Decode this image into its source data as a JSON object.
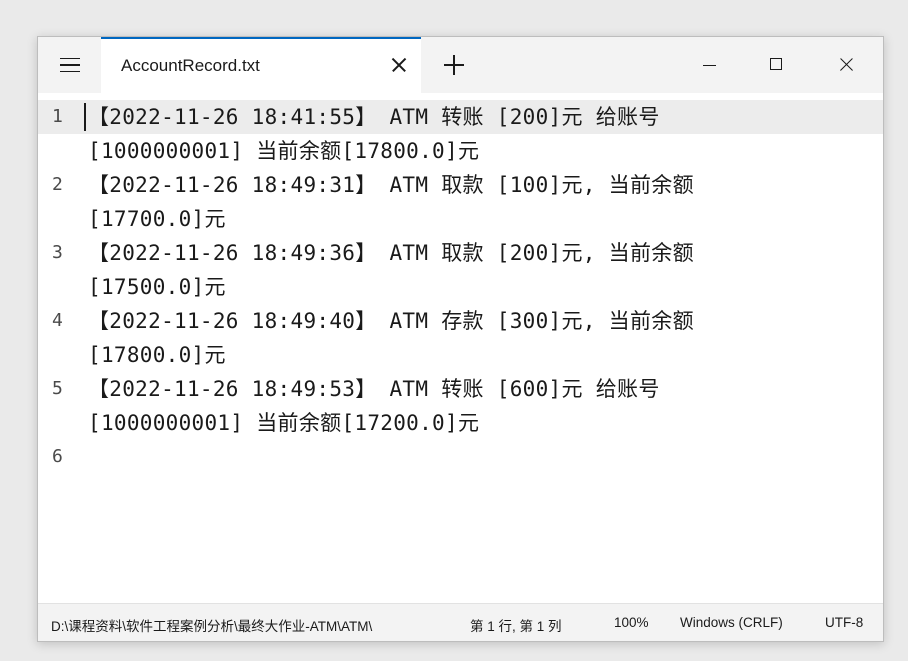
{
  "window": {
    "tab_title": "AccountRecord.txt"
  },
  "editor": {
    "lines": [
      {
        "number": "1",
        "text": "【2022-11-26 18:41:55】 ATM 转账 [200]元 给账号[1000000001] 当前余额[17800.0]元"
      },
      {
        "number": "2",
        "text": "【2022-11-26 18:49:31】 ATM 取款 [100]元, 当前余额[17700.0]元"
      },
      {
        "number": "3",
        "text": "【2022-11-26 18:49:36】 ATM 取款 [200]元, 当前余额[17500.0]元"
      },
      {
        "number": "4",
        "text": "【2022-11-26 18:49:40】 ATM 存款 [300]元, 当前余额[17800.0]元"
      },
      {
        "number": "5",
        "text": "【2022-11-26 18:49:53】 ATM 转账 [600]元 给账号[1000000001] 当前余额[17200.0]元"
      },
      {
        "number": "6",
        "text": ""
      }
    ],
    "display_rows": [
      [
        "【2022-11-26 18:41:55】 ATM 转账 [200]元 给账号",
        "[1000000001] 当前余额[17800.0]元"
      ],
      [
        "【2022-11-26 18:49:31】 ATM 取款 [100]元, 当前余额",
        "[17700.0]元"
      ],
      [
        "【2022-11-26 18:49:36】 ATM 取款 [200]元, 当前余额",
        "[17500.0]元"
      ],
      [
        "【2022-11-26 18:49:40】 ATM 存款 [300]元, 当前余额",
        "[17800.0]元"
      ],
      [
        "【2022-11-26 18:49:53】 ATM 转账 [600]元 给账号",
        "[1000000001] 当前余额[17200.0]元"
      ],
      [
        ""
      ]
    ]
  },
  "statusbar": {
    "path": "D:\\课程资料\\软件工程案例分析\\最终大作业-ATM\\ATM\\",
    "position": "第 1 行, 第 1 列",
    "zoom": "100%",
    "line_ending": "Windows (CRLF)",
    "encoding": "UTF-8"
  },
  "icons": {
    "menu": "hamburger-menu-icon",
    "tab_close": "close-icon",
    "new_tab": "plus-icon",
    "minimize": "minimize-icon",
    "maximize": "maximize-icon",
    "close": "close-icon"
  },
  "colors": {
    "accent": "#0067c0",
    "current_line": "#ececec"
  }
}
